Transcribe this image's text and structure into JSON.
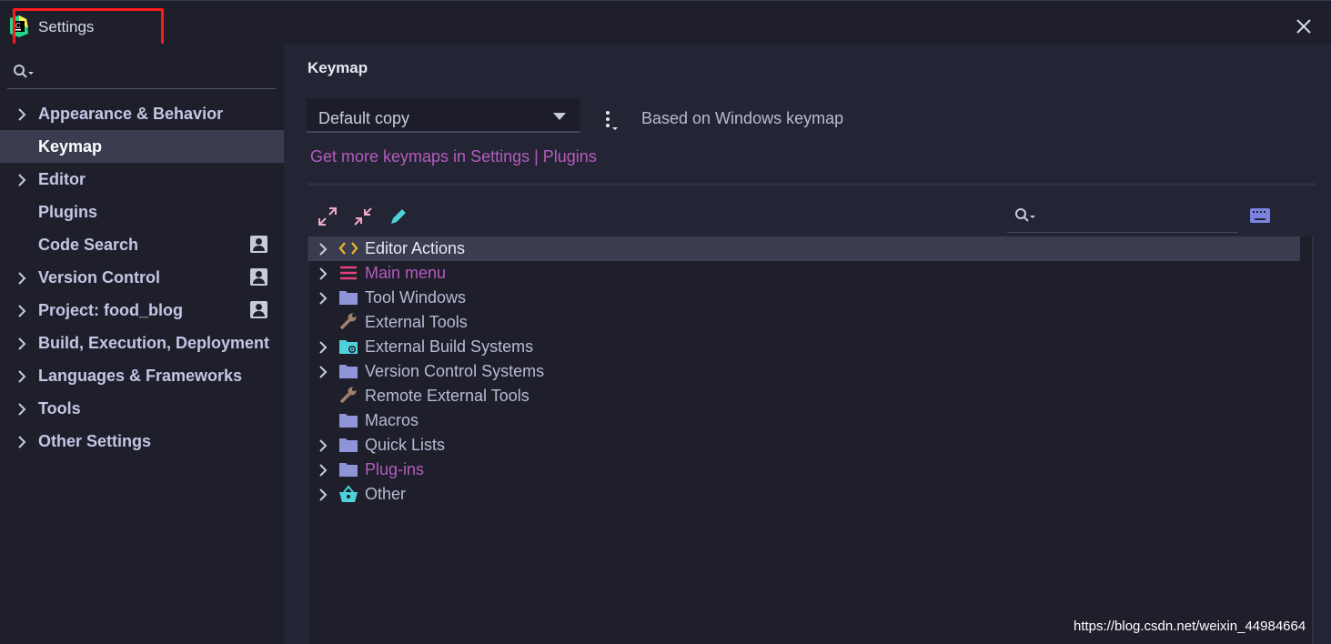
{
  "window": {
    "title": "Settings"
  },
  "sidebar": {
    "items": [
      {
        "label": "Appearance & Behavior",
        "expandable": true,
        "selected": false,
        "project_icon": false
      },
      {
        "label": "Keymap",
        "expandable": false,
        "selected": true,
        "project_icon": false
      },
      {
        "label": "Editor",
        "expandable": true,
        "selected": false,
        "project_icon": false
      },
      {
        "label": "Plugins",
        "expandable": false,
        "selected": false,
        "project_icon": false
      },
      {
        "label": "Code Search",
        "expandable": false,
        "selected": false,
        "project_icon": true
      },
      {
        "label": "Version Control",
        "expandable": true,
        "selected": false,
        "project_icon": true
      },
      {
        "label": "Project: food_blog",
        "expandable": true,
        "selected": false,
        "project_icon": true
      },
      {
        "label": "Build, Execution, Deployment",
        "expandable": true,
        "selected": false,
        "project_icon": false
      },
      {
        "label": "Languages & Frameworks",
        "expandable": true,
        "selected": false,
        "project_icon": false
      },
      {
        "label": "Tools",
        "expandable": true,
        "selected": false,
        "project_icon": false
      },
      {
        "label": "Other Settings",
        "expandable": true,
        "selected": false,
        "project_icon": false
      }
    ]
  },
  "main": {
    "title": "Keymap",
    "keymap_select": {
      "value": "Default copy"
    },
    "based_on": "Based on Windows keymap",
    "plugins_link": "Get more keymaps in Settings | Plugins",
    "tree_search": {
      "placeholder": ""
    },
    "tree": [
      {
        "label": "Editor Actions",
        "icon": "code-brackets-icon",
        "expandable": true,
        "selected": true,
        "color": "white"
      },
      {
        "label": "Main menu",
        "icon": "menu-icon",
        "expandable": true,
        "selected": false,
        "color": "purple"
      },
      {
        "label": "Tool Windows",
        "icon": "folder-icon",
        "expandable": true,
        "selected": false,
        "color": "normal"
      },
      {
        "label": "External Tools",
        "icon": "wrench-icon",
        "expandable": false,
        "selected": false,
        "color": "normal"
      },
      {
        "label": "External Build Systems",
        "icon": "folder-gear-icon",
        "expandable": true,
        "selected": false,
        "color": "normal"
      },
      {
        "label": "Version Control Systems",
        "icon": "folder-icon",
        "expandable": true,
        "selected": false,
        "color": "normal"
      },
      {
        "label": "Remote External Tools",
        "icon": "wrench-icon",
        "expandable": false,
        "selected": false,
        "color": "normal"
      },
      {
        "label": "Macros",
        "icon": "folder-icon",
        "expandable": false,
        "selected": false,
        "color": "normal"
      },
      {
        "label": "Quick Lists",
        "icon": "folder-icon",
        "expandable": true,
        "selected": false,
        "color": "normal"
      },
      {
        "label": "Plug-ins",
        "icon": "folder-icon",
        "expandable": true,
        "selected": false,
        "color": "purple"
      },
      {
        "label": "Other",
        "icon": "basket-icon",
        "expandable": true,
        "selected": false,
        "color": "normal"
      }
    ]
  },
  "watermark": "https://blog.csdn.net/weixin_44984664",
  "colors": {
    "background": "#1e1f2b",
    "panel": "#232534",
    "selection": "#3a3d4f",
    "link_purple": "#b55bbf",
    "highlight_red": "#ff1a1a",
    "teal_icon": "#4fd1d9",
    "folder": "#8f94d8"
  }
}
